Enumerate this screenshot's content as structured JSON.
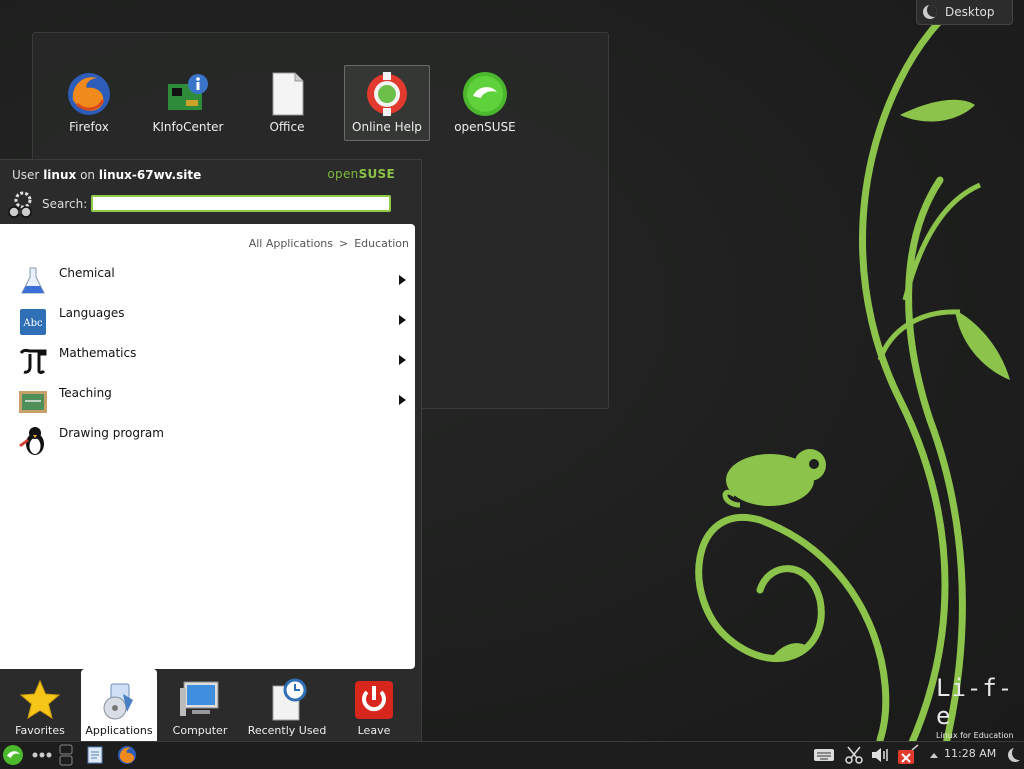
{
  "desktop": {
    "toolbox_label": "Desktop",
    "icons": [
      {
        "label": "Firefox",
        "icon": "firefox-icon"
      },
      {
        "label": "KInfoCenter",
        "icon": "kinfocenter-icon"
      },
      {
        "label": "Office",
        "icon": "office-document-icon"
      },
      {
        "label": "Online Help",
        "icon": "help-lifebuoy-icon"
      },
      {
        "label": "openSUSE",
        "icon": "opensuse-icon"
      }
    ],
    "branding": {
      "title": "Li-f-e",
      "subtitle": "Linux for Education"
    }
  },
  "kickoff": {
    "user_prefix": "User",
    "user_name": "linux",
    "host_prefix": "on",
    "host_name": "linux-67wv.site",
    "brand_open": "open",
    "brand_suse": "SUSE",
    "search_label": "Search:",
    "search_value": "",
    "breadcrumb": {
      "root": "All Applications",
      "sep": ">",
      "current": "Education"
    },
    "items": [
      {
        "label": "Chemical",
        "icon": "flask-icon",
        "submenu": true
      },
      {
        "label": "Languages",
        "icon": "abc-book-icon",
        "submenu": true
      },
      {
        "label": "Mathematics",
        "icon": "pi-icon",
        "submenu": true
      },
      {
        "label": "Teaching",
        "icon": "chalkboard-icon",
        "submenu": true
      },
      {
        "label": "Drawing program",
        "icon": "tux-penguin-icon",
        "submenu": false
      }
    ],
    "tabs": [
      {
        "label": "Favorites",
        "icon": "star-icon"
      },
      {
        "label": "Applications",
        "icon": "applications-icon",
        "active": true
      },
      {
        "label": "Computer",
        "icon": "computer-monitor-icon"
      },
      {
        "label": "Recently Used",
        "icon": "recent-clock-icon"
      },
      {
        "label": "Leave",
        "icon": "power-icon"
      }
    ]
  },
  "taskbar": {
    "clock": "11:28 AM",
    "tray_icons": [
      "keyboard-icon",
      "klipper-scissors-icon",
      "volume-icon",
      "network-disconnected-icon",
      "tray-expand-icon",
      "desktop-toolbox-icon"
    ],
    "launcher_icons": [
      "kickoff-launcher-icon",
      "pager-icon",
      "activity-icon",
      "file-manager-icon",
      "firefox-icon"
    ]
  },
  "colors": {
    "accent": "#8bc34a",
    "background": "#1e1f1e",
    "panel": "#2a2b2a"
  }
}
